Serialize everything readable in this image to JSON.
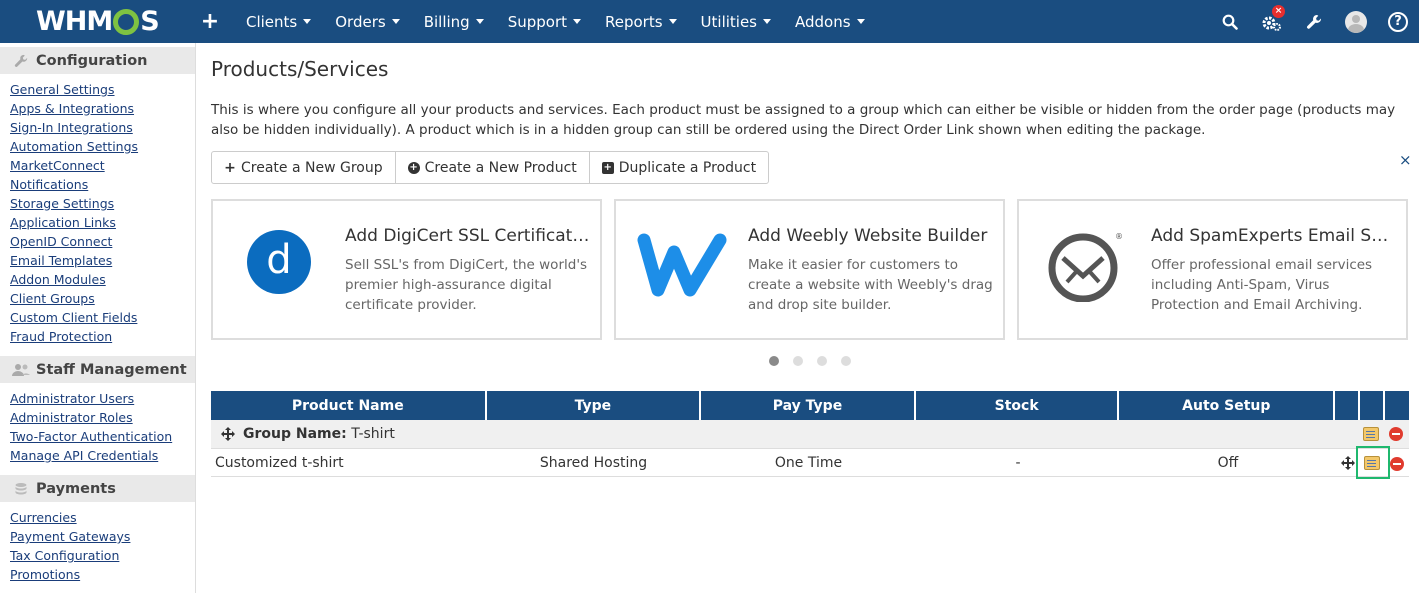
{
  "brand": {
    "logo_text_left": "WHM",
    "logo_text_right": "S"
  },
  "nav": {
    "items": [
      "Clients",
      "Orders",
      "Billing",
      "Support",
      "Reports",
      "Utilities",
      "Addons"
    ],
    "badge": "×"
  },
  "sidebar": {
    "sections": [
      {
        "title": "Configuration",
        "icon": "wrench-icon",
        "links": [
          "General Settings",
          "Apps & Integrations",
          "Sign-In Integrations",
          "Automation Settings",
          "MarketConnect",
          "Notifications",
          "Storage Settings",
          "Application Links",
          "OpenID Connect",
          "Email Templates",
          "Addon Modules",
          "Client Groups",
          "Custom Client Fields",
          "Fraud Protection"
        ]
      },
      {
        "title": "Staff Management",
        "icon": "users-icon",
        "links": [
          "Administrator Users",
          "Administrator Roles",
          "Two-Factor Authentication",
          "Manage API Credentials"
        ]
      },
      {
        "title": "Payments",
        "icon": "coins-icon",
        "links": [
          "Currencies",
          "Payment Gateways",
          "Tax Configuration",
          "Promotions"
        ]
      }
    ]
  },
  "main": {
    "title": "Products/Services",
    "intro": "This is where you configure all your products and services. Each product must be assigned to a group which can either be visible or hidden from the order page (products may also be hidden individually). A product which is in a hidden group can still be ordered using the Direct Order Link shown when editing the package.",
    "buttons": {
      "create_group": "Create a New Group",
      "create_product": "Create a New Product",
      "duplicate_product": "Duplicate a Product"
    },
    "close_label": "×",
    "promos": [
      {
        "title": "Add DigiCert SSL Certificates",
        "desc": "Sell SSL's from DigiCert, the world's premier high-assurance digital certificate provider.",
        "logo_letter": "d"
      },
      {
        "title": "Add Weebly Website Builder",
        "desc": "Make it easier for customers to create a website with Weebly's drag and drop site builder.",
        "logo_letter": "w"
      },
      {
        "title": "Add SpamExperts Email Sec…",
        "desc": "Offer professional email services including Anti-Spam, Virus Protection and Email Archiving.",
        "logo_letter": "®"
      }
    ],
    "carousel": {
      "count": 4,
      "active": 1
    },
    "table": {
      "headers": [
        "Product Name",
        "Type",
        "Pay Type",
        "Stock",
        "Auto Setup"
      ],
      "group_label": "Group Name:",
      "group_name": "T-shirt",
      "rows": [
        {
          "name": "Customized t-shirt",
          "type": "Shared Hosting",
          "pay_type": "One Time",
          "stock": "-",
          "auto_setup": "Off"
        }
      ]
    }
  },
  "colors": {
    "navbar": "#1a4d80",
    "logo_gear": "#7ec242",
    "digicert": "#0b6cbf",
    "weebly": "#1d8ee8",
    "highlight": "#1fb86e",
    "delete": "#e03b2e"
  }
}
